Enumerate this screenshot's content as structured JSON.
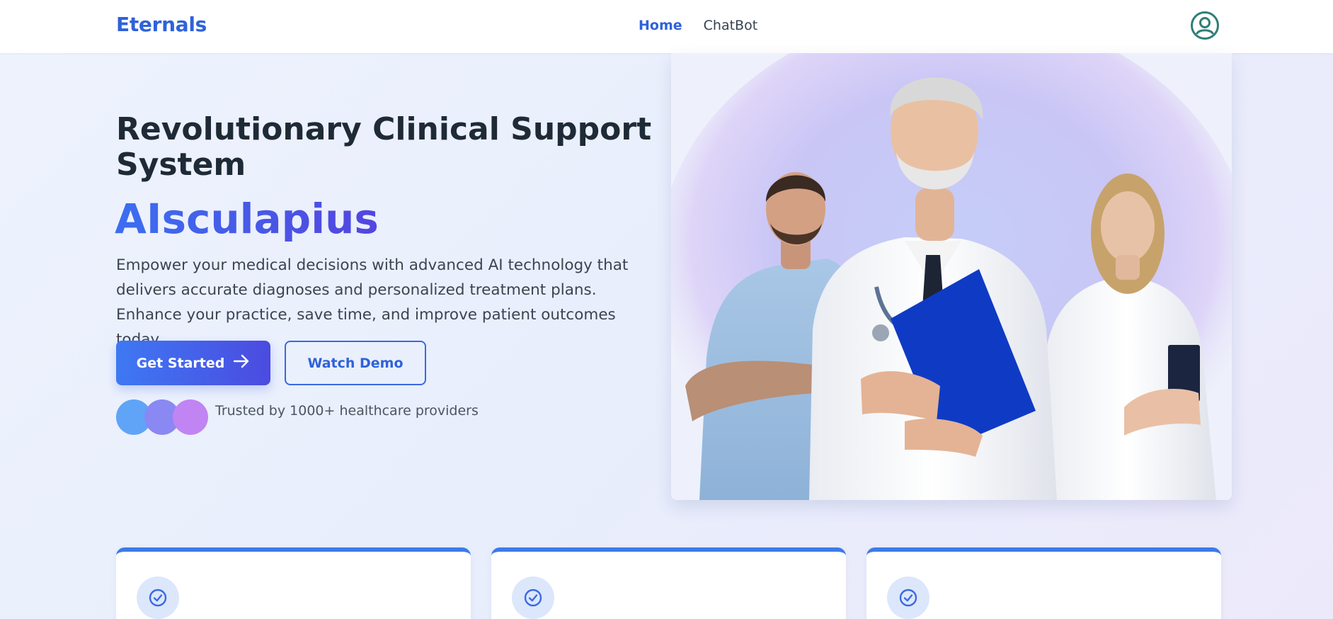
{
  "nav": {
    "brand": "Eternals",
    "links": [
      {
        "label": "Home",
        "active": true
      },
      {
        "label": "ChatBot",
        "active": false
      }
    ],
    "profile_icon": "user-circle-icon"
  },
  "hero": {
    "title": "Revolutionary Clinical Support System",
    "brand_name": "AIsculapius",
    "description": "Empower your medical decisions with advanced AI technology that delivers accurate diagnoses and personalized treatment plans. Enhance your practice, save time, and improve patient outcomes today.",
    "primary_button": "Get Started",
    "primary_button_icon": "arrow-right-icon",
    "secondary_button": "Watch Demo",
    "trusted_text": "Trusted by 1000+ healthcare providers",
    "avatar_colors": [
      "#5fa4f7",
      "#8a88f2",
      "#c184f3"
    ]
  },
  "features": [
    {
      "icon": "check-circle-icon"
    },
    {
      "icon": "check-circle-icon"
    },
    {
      "icon": "check-circle-icon"
    }
  ],
  "colors": {
    "accent": "#2f62d9",
    "gradient_start": "#3e78f3",
    "gradient_end": "#4b4be0",
    "card_border": "#3b7be8"
  }
}
